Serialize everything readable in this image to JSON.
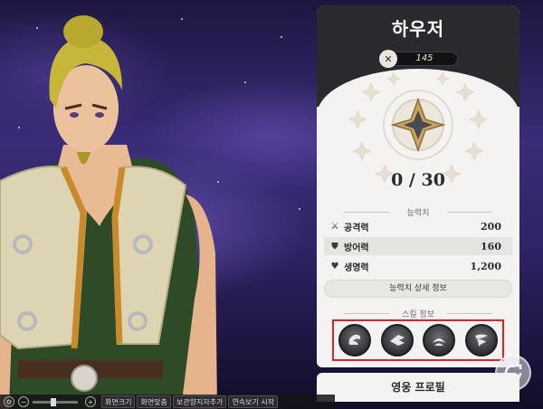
{
  "hero": {
    "name": "하우저",
    "power": "145",
    "progress": "0 / 30"
  },
  "stats": {
    "section_title": "능력치",
    "rows": [
      {
        "icon": "sword-icon",
        "label": "공격력",
        "value": "200"
      },
      {
        "icon": "shield-icon",
        "label": "방어력",
        "value": "160"
      },
      {
        "icon": "heart-icon",
        "label": "생명력",
        "value": "1,200"
      }
    ],
    "detail_button": "능력치 상세 정보"
  },
  "skills": {
    "section_title": "스킬 정보",
    "items": [
      "skill-1-icon",
      "skill-2-icon",
      "skill-3-icon",
      "skill-4-icon"
    ]
  },
  "profile_button": "영웅 프로필",
  "toolbar": {
    "items": [
      "화면크기",
      "화면맞춤",
      "보관향지자추가",
      "연속보기 시작"
    ]
  },
  "colors": {
    "panel_bg": "#f4f3f1",
    "header_bg": "#2a2a2e",
    "highlight": "#e0222a"
  }
}
